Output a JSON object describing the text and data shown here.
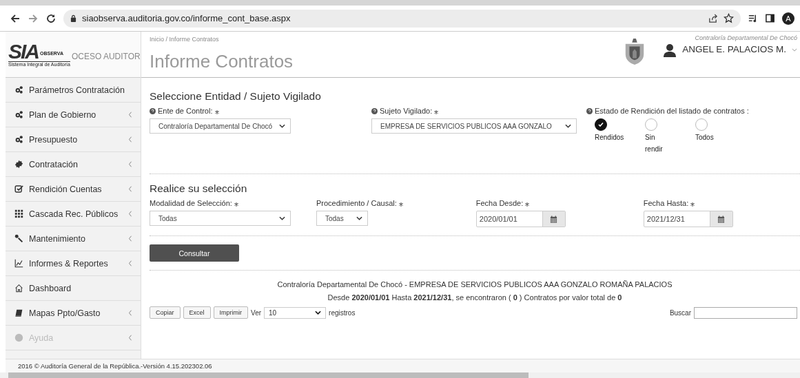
{
  "browser": {
    "url": "siaobserva.auditoria.gov.co/informe_cont_base.aspx",
    "profile_letter": "A"
  },
  "sidebar": {
    "logo_text": "SIA",
    "logo_badge": "OBSERVA",
    "logo_caption": "Sistema Integral de Auditoría",
    "background_text": "OCESO AUDITOR",
    "items": [
      {
        "label": "Parámetros Contratación",
        "expandable": false
      },
      {
        "label": "Plan de Gobierno",
        "expandable": true
      },
      {
        "label": "Presupuesto",
        "expandable": true
      },
      {
        "label": "Contratación",
        "expandable": true
      },
      {
        "label": "Rendición Cuentas",
        "expandable": true
      },
      {
        "label": "Cascada Rec. Públicos",
        "expandable": true
      },
      {
        "label": "Mantenimiento",
        "expandable": true
      },
      {
        "label": "Informes & Reportes",
        "expandable": true
      },
      {
        "label": "Dashboard",
        "expandable": false
      },
      {
        "label": "Mapas Ppto/Gasto",
        "expandable": true
      },
      {
        "label": "Ayuda",
        "expandable": true
      }
    ]
  },
  "header": {
    "breadcrumb": "Inicio / Informe Contratos",
    "title": "Informe Contratos",
    "entity": "Contraloría Departamental De Chocó",
    "user": "ANGEL E. PALACIOS M."
  },
  "section_entity": {
    "title": "Seleccione Entidad / Sujeto Vigilado",
    "ente": {
      "label": "Ente de Control:",
      "required": true,
      "value": "Contraloría Departamental De Chocó"
    },
    "sujeto": {
      "label": "Sujeto Vigilado:",
      "required": true,
      "value": "EMPRESA DE SERVICIOS PUBLICOS AAA GONZALO"
    },
    "estado": {
      "label": "Estado de Rendición del listado de contratos :",
      "options": [
        {
          "label": "Rendidos",
          "selected": true
        },
        {
          "label": "Sin rendir",
          "selected": false
        },
        {
          "label": "Todos",
          "selected": false
        }
      ]
    }
  },
  "section_selection": {
    "title": "Realice su selección",
    "modalidad": {
      "label": "Modalidad de Selección:",
      "required": true,
      "value": "Todas"
    },
    "procedimiento": {
      "label": "Procedimiento / Causal:",
      "required": true,
      "value": "Todas"
    },
    "fecha_desde": {
      "label": "Fecha Desde:",
      "required": true,
      "value": "2020/01/01"
    },
    "fecha_hasta": {
      "label": "Fecha Hasta:",
      "required": true,
      "value": "2021/12/31"
    }
  },
  "submit_button": "Consultar",
  "summary": {
    "title": "Contraloría Departamental De Chocó - EMPRESA DE SERVICIOS PUBLICOS AAA GONZALO ROMAÑA PALACIOS",
    "detail": "Desde **2020/01/01** Hasta **2021/12/31**, se encontraron ( **0** ) Contratos por valor total de **0**"
  },
  "table_toolbar": {
    "buttons": [
      "Copiar",
      "Excel",
      "Imprimir"
    ],
    "show_label": "Ver",
    "page_size": "10",
    "page_suffix": "registros",
    "search_label": "Buscar"
  },
  "footer": "2016 © Auditoría General de la República.-Versión 4.15.202302.06"
}
